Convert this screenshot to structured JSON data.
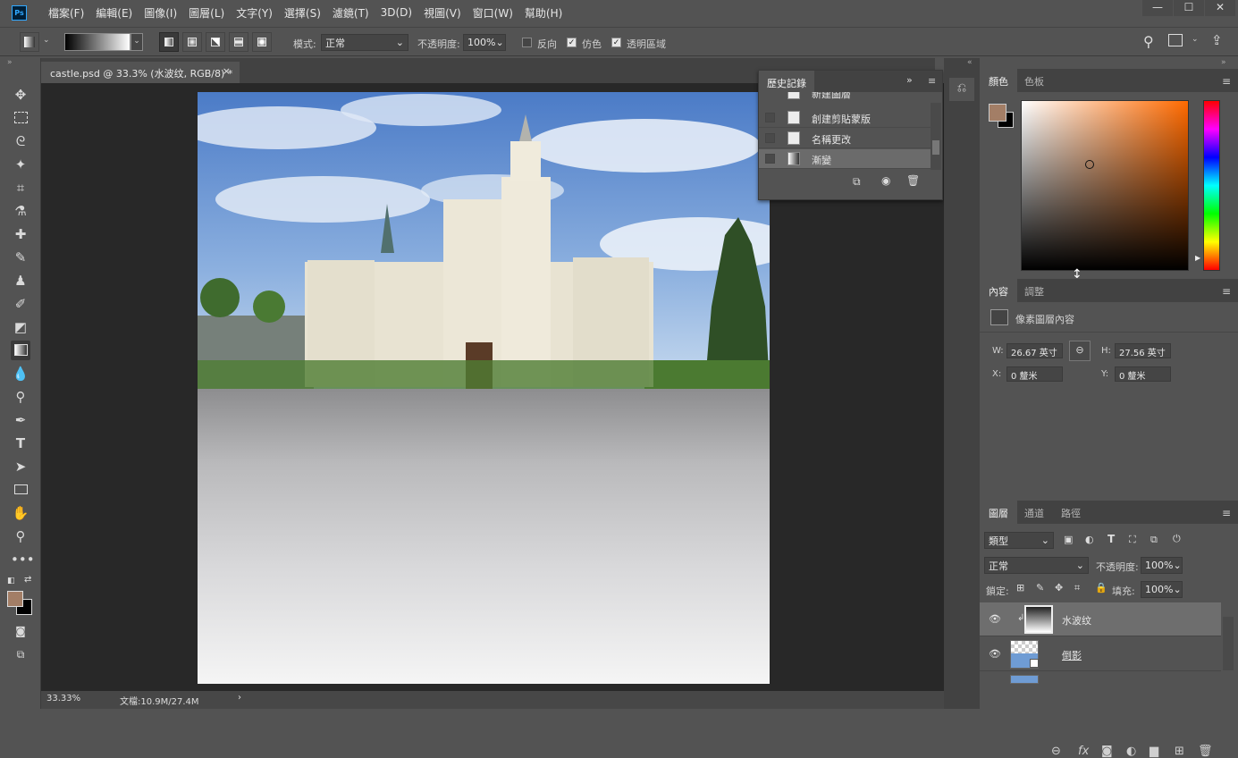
{
  "app": {
    "logo": "Ps"
  },
  "menubar": {
    "items": [
      "檔案(F)",
      "編輯(E)",
      "圖像(I)",
      "圖層(L)",
      "文字(Y)",
      "選擇(S)",
      "濾鏡(T)",
      "3D(D)",
      "視圖(V)",
      "窗口(W)",
      "幫助(H)"
    ]
  },
  "window_controls": {
    "minimize": "—",
    "maximize": "☐",
    "close": "✕"
  },
  "options": {
    "mode_label": "模式:",
    "mode_value": "正常",
    "opacity_label": "不透明度:",
    "opacity_value": "100%",
    "reverse_label": "反向",
    "dither_label": "仿色",
    "transparency_label": "透明區域",
    "reverse_checked": false,
    "dither_checked": true,
    "transparency_checked": true
  },
  "document": {
    "tab_title": "castle.psd @ 33.3% (水波纹, RGB/8) *",
    "tab_close": "×",
    "zoom": "33.33%",
    "doc_info": "文檔:10.9M/27.4M",
    "status_arrow": "›"
  },
  "history_panel": {
    "title": "歷史記錄",
    "expand": "»",
    "items": [
      "新建圖層",
      "創建剪貼蒙版",
      "名稱更改",
      "漸變"
    ],
    "active_index": 3
  },
  "color_panel": {
    "tabs": [
      "顏色",
      "色板"
    ],
    "foreground": "#a37e66",
    "background": "#000000",
    "hue_color": "#ff6a00"
  },
  "properties_panel": {
    "tabs": [
      "內容",
      "調整"
    ],
    "subtitle": "像素圖層內容",
    "w_label": "W:",
    "w_value": "26.67 英寸",
    "h_label": "H:",
    "h_value": "27.56 英寸",
    "x_label": "X:",
    "x_value": "0 釐米",
    "y_label": "Y:",
    "y_value": "0 釐米"
  },
  "layers_panel": {
    "tabs": [
      "圖層",
      "通道",
      "路徑"
    ],
    "filter_label": "類型",
    "blend_mode": "正常",
    "opacity_label": "不透明度:",
    "opacity_value": "100%",
    "lock_label": "鎖定:",
    "fill_label": "填充:",
    "fill_value": "100%",
    "layers": [
      {
        "name": "水波纹",
        "visible": true,
        "selected": true
      },
      {
        "name": "倒影",
        "visible": true,
        "selected": false
      }
    ],
    "bottom_icons": [
      "link-icon",
      "fx-icon",
      "mask-icon",
      "adjustment-icon",
      "folder-icon",
      "new-layer-icon",
      "trash-icon"
    ]
  }
}
